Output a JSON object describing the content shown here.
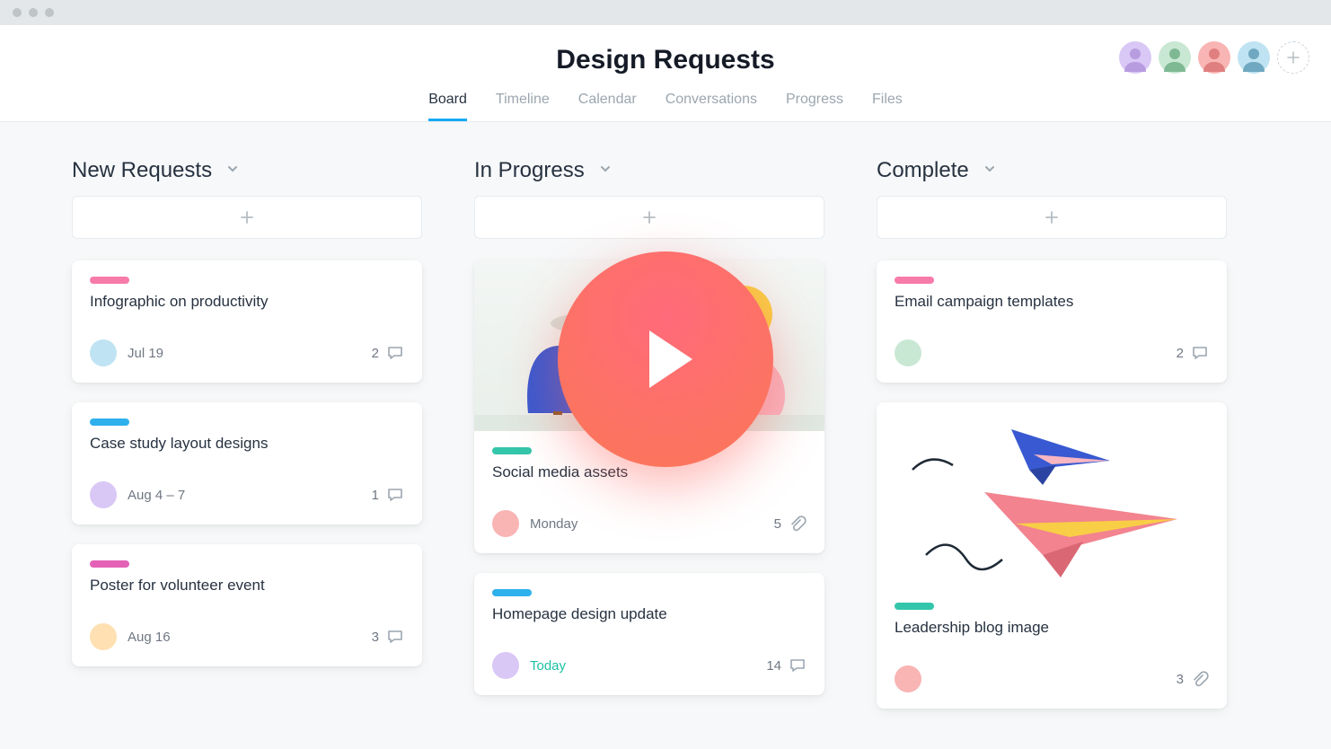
{
  "header": {
    "title": "Design Requests",
    "tabs": [
      "Board",
      "Timeline",
      "Calendar",
      "Conversations",
      "Progress",
      "Files"
    ],
    "active_tab": "Board",
    "avatars": [
      {
        "bg": "#d9c7f5"
      },
      {
        "bg": "#c9e8d4"
      },
      {
        "bg": "#f9b4b4"
      },
      {
        "bg": "#bfe3f2"
      }
    ]
  },
  "columns": [
    {
      "title": "New Requests",
      "cards": [
        {
          "tag": "pink",
          "title": "Infographic on productivity",
          "avatar": "#bfe3f2",
          "due": "Jul 19",
          "count": "2",
          "icon": "comment"
        },
        {
          "tag": "blue",
          "title": "Case study layout designs",
          "avatar": "#d9c7f5",
          "due": "Aug 4 – 7",
          "count": "1",
          "icon": "comment"
        },
        {
          "tag": "magenta",
          "title": "Poster for volunteer event",
          "avatar": "#ffe0b2",
          "due": "Aug 16",
          "count": "3",
          "icon": "comment"
        }
      ]
    },
    {
      "title": "In Progress",
      "cards": [
        {
          "cover": "scene",
          "tag": "teal",
          "title": "Social media assets",
          "avatar": "#f9b4b4",
          "due": "Monday",
          "count": "5",
          "icon": "attach"
        },
        {
          "tag": "blue",
          "title": "Homepage design update",
          "avatar": "#d9c7f5",
          "due": "Today",
          "due_today": true,
          "count": "14",
          "icon": "comment"
        }
      ]
    },
    {
      "title": "Complete",
      "cards": [
        {
          "tag": "pink",
          "title": "Email campaign templates",
          "avatar": "#c9e8d4",
          "due": "",
          "count": "2",
          "icon": "comment"
        },
        {
          "cover": "planes",
          "tag": "teal",
          "title": "Leadership blog image",
          "avatar": "#f9b4b4",
          "due": "",
          "count": "3",
          "icon": "attach"
        }
      ]
    }
  ]
}
